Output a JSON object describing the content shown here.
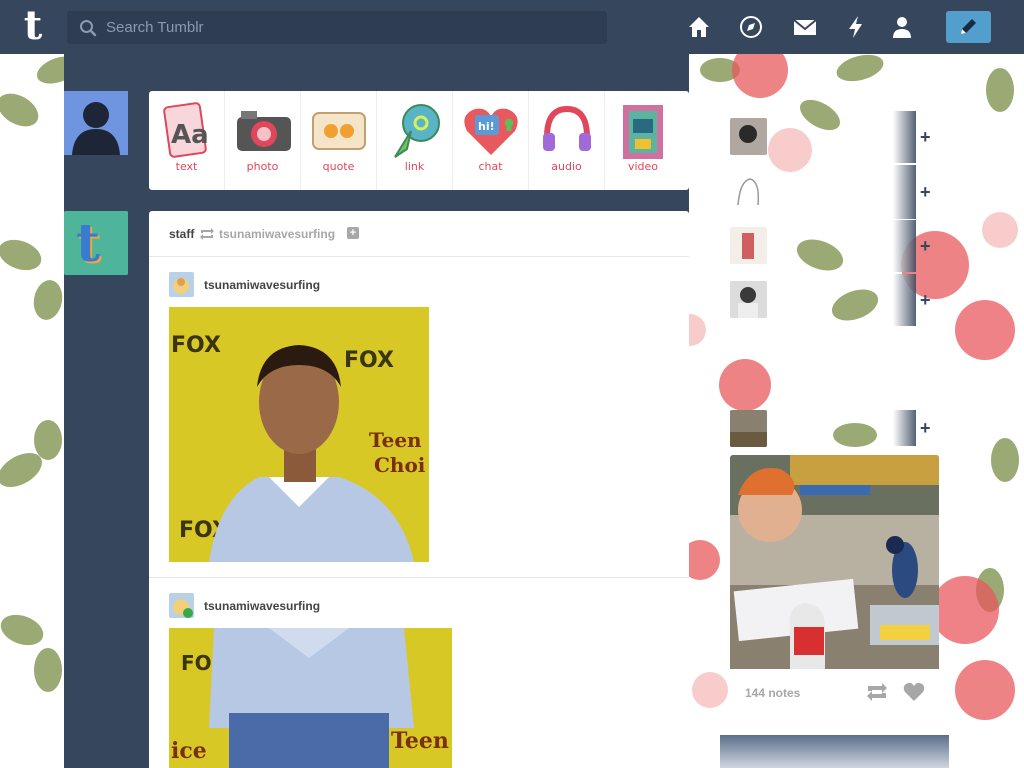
{
  "search": {
    "placeholder": "Search Tumblr"
  },
  "nav": {
    "icons": [
      "home-icon",
      "explore-icon",
      "inbox-icon",
      "activity-icon",
      "account-icon"
    ],
    "compose_icon": "pencil-icon"
  },
  "post_types": [
    {
      "label": "text",
      "icon": "text-icon"
    },
    {
      "label": "photo",
      "icon": "camera-icon"
    },
    {
      "label": "quote",
      "icon": "quote-icon"
    },
    {
      "label": "link",
      "icon": "link-icon"
    },
    {
      "label": "chat",
      "icon": "chat-icon"
    },
    {
      "label": "audio",
      "icon": "headphones-icon"
    },
    {
      "label": "video",
      "icon": "video-icon"
    }
  ],
  "feed": {
    "reblog_header": {
      "poster": "staff",
      "source": "tsunamiwavesurfing",
      "follow_glyph": "+"
    },
    "entries": [
      {
        "blog_name": "tsunamiwavesurfing"
      },
      {
        "blog_name": "tsunamiwavesurfing"
      }
    ]
  },
  "sidebar": {
    "follow_glyph": "+",
    "radar": {
      "notes": "144 notes"
    }
  },
  "colors": {
    "topbar": "#36465d",
    "accent": "#529ecc",
    "label_red": "#e0475a"
  }
}
